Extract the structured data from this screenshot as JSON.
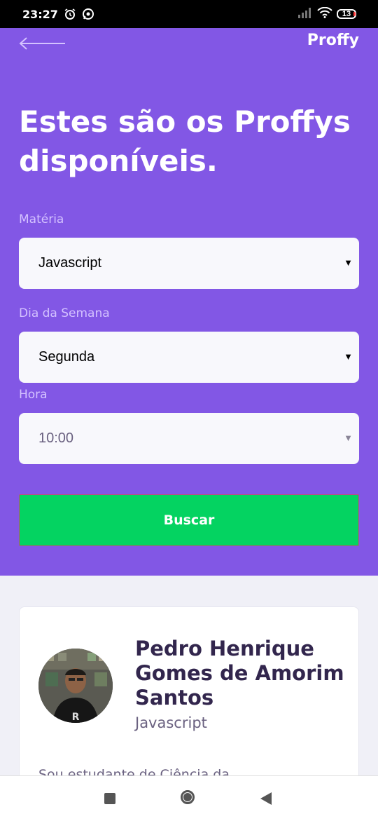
{
  "status_bar": {
    "time": "23:27",
    "battery_level": "13",
    "icons": [
      "alarm-icon",
      "whatsapp-icon",
      "signal-icon",
      "wifi-icon",
      "battery-icon"
    ]
  },
  "header": {
    "back_icon": "arrow-left-icon",
    "logo": "Proffy",
    "title": "Estes são os Proffys disponíveis.",
    "background_color": "#8257e5"
  },
  "filters": {
    "subject": {
      "label": "Matéria",
      "value": "Javascript"
    },
    "weekday": {
      "label": "Dia da Semana",
      "value": "Segunda"
    },
    "time": {
      "label": "Hora",
      "value": "10:00"
    },
    "search_button": "Buscar",
    "button_color": "#04d361"
  },
  "teacher_card": {
    "name": "Pedro Henrique Gomes de Amorim Santos",
    "subject": "Javascript",
    "bio_preview": "Sou estudante de Ciência da"
  },
  "nav_bar": {
    "icons": [
      "recent-apps-icon",
      "home-icon",
      "back-icon"
    ]
  }
}
